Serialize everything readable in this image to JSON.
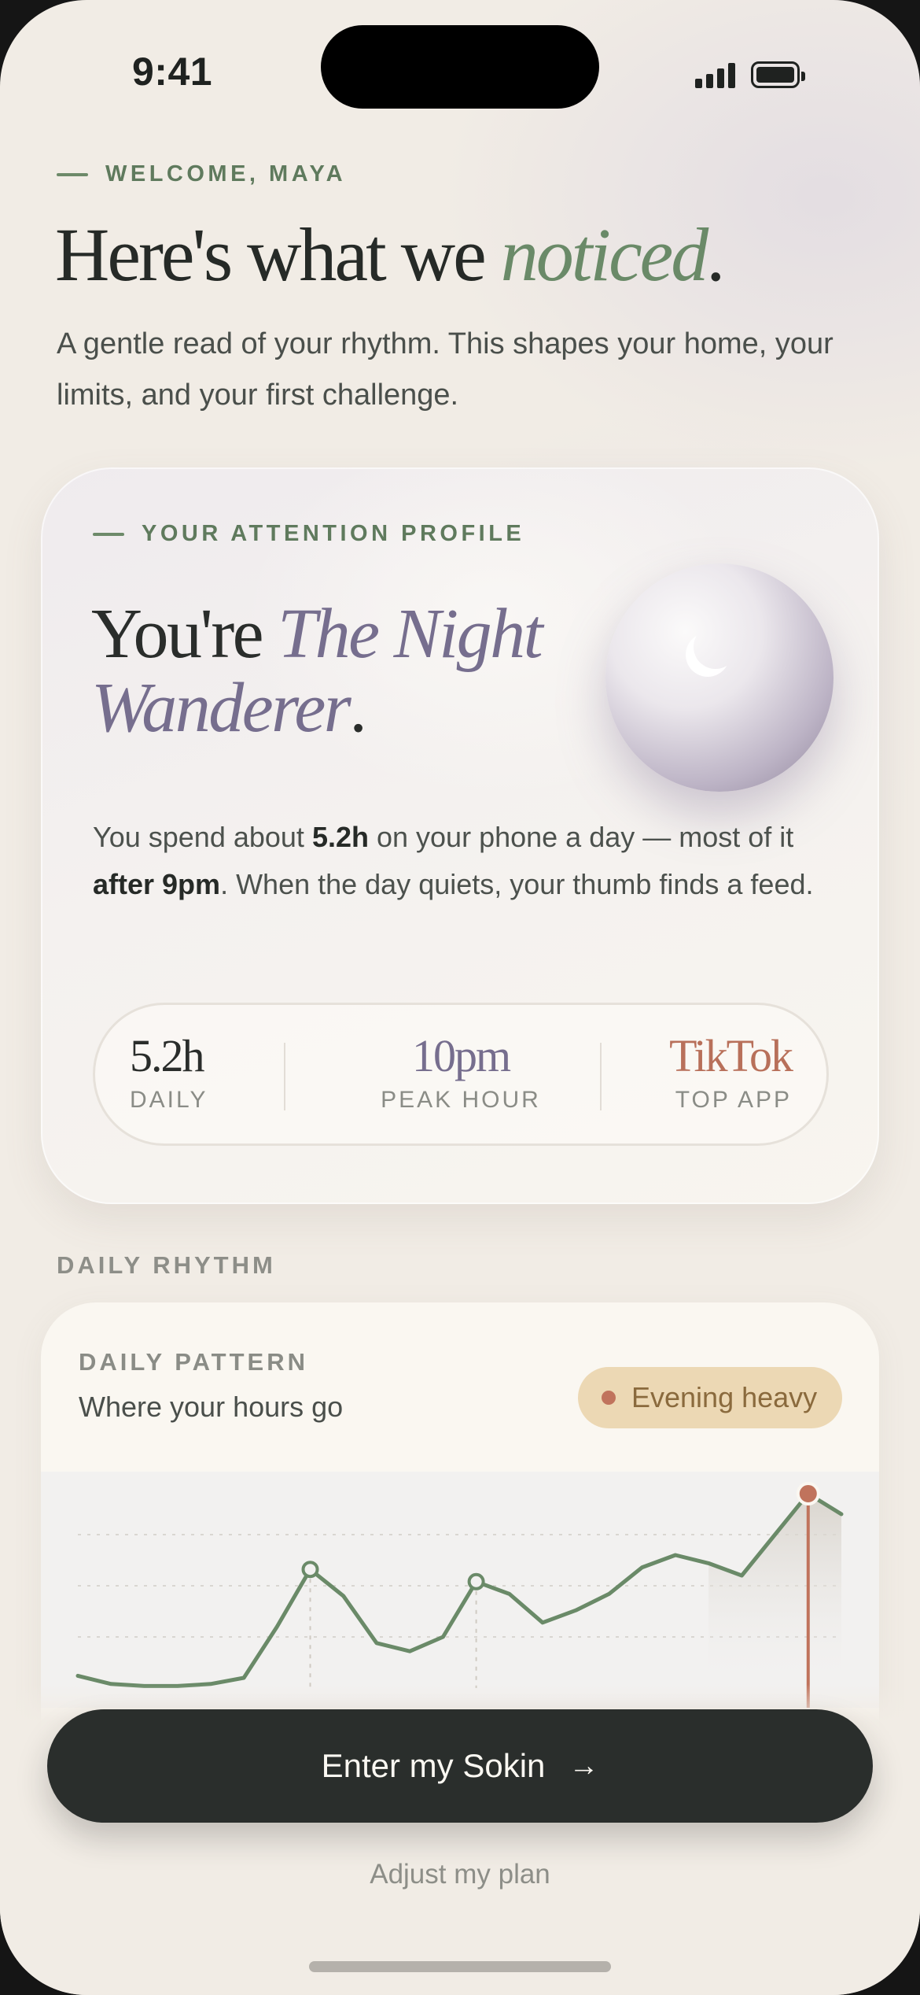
{
  "status_bar": {
    "time": "9:41"
  },
  "welcome": {
    "eyebrow": "WELCOME, MAYA",
    "headline_prefix": "Here's what we ",
    "headline_emphasis": "noticed",
    "headline_suffix": ".",
    "intro": "A gentle read of your rhythm. This shapes your home, your limits, and your first challenge."
  },
  "profile": {
    "eyebrow": "YOUR ATTENTION PROFILE",
    "title_prefix": "You're ",
    "title_emphasis_1": "The Night",
    "title_emphasis_2": "Wanderer",
    "title_suffix": ".",
    "desc_1": "You spend about ",
    "desc_hours": "5.2h",
    "desc_2": " on your phone a day — most of it ",
    "desc_time": "after 9pm",
    "desc_3": ". When the day quiets, your thumb finds a feed.",
    "stats": [
      {
        "value": "5.2h",
        "label": "DAILY"
      },
      {
        "value": "10pm",
        "label": "PEAK HOUR"
      },
      {
        "value": "TikTok",
        "label": "TOP APP"
      }
    ],
    "orb_icon": "moon-icon"
  },
  "rhythm": {
    "section_label": "DAILY RHYTHM",
    "eyebrow": "DAILY PATTERN",
    "title": "Where your hours go",
    "badge": "Evening heavy"
  },
  "colors": {
    "background": "#f1ece5",
    "sage": "#6a8a68",
    "lavender": "#766e8e",
    "terracotta": "#c0735c",
    "dark": "#2a2e2c",
    "badge_bg": "#ecd8b4"
  },
  "chart_data": {
    "type": "line",
    "title": "",
    "xlabel": "",
    "ylabel": "",
    "grid": true,
    "x": [
      0,
      1,
      2,
      3,
      4,
      5,
      6,
      7,
      8,
      9,
      10,
      11,
      12,
      13,
      14,
      15,
      16,
      17,
      18,
      19,
      20,
      21,
      22,
      23
    ],
    "series": [
      {
        "values": [
          0.06,
          0.02,
          0.01,
          0.01,
          0.02,
          0.05,
          0.3,
          0.58,
          0.45,
          0.22,
          0.18,
          0.25,
          0.52,
          0.46,
          0.32,
          0.38,
          0.46,
          0.59,
          0.65,
          0.61,
          0.55,
          0.75,
          0.95,
          0.85
        ]
      }
    ],
    "highlighted_points": [
      7,
      12
    ],
    "peak_index": 22,
    "ylim": [
      0,
      1
    ]
  },
  "actions": {
    "primary": "Enter my Sokin",
    "primary_icon": "arrow-right-icon",
    "secondary": "Adjust my plan"
  }
}
